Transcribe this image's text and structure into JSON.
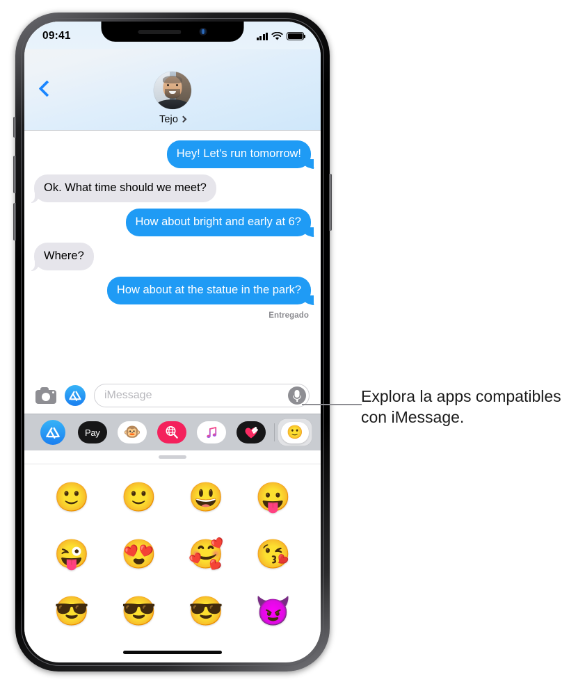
{
  "status_bar": {
    "time": "09:41",
    "signal_icon": "cellular-bars-icon",
    "wifi_icon": "wifi-icon",
    "battery_icon": "battery-full-icon"
  },
  "nav_header": {
    "back_icon": "chevron-left-icon",
    "contact_name": "Tejo",
    "contact_chevron_icon": "chevron-right-icon",
    "avatar_icon": "contact-avatar-photo"
  },
  "conversation": {
    "messages": [
      {
        "text": "Hey! Let's run tomorrow!",
        "side": "out"
      },
      {
        "text": "Ok. What time should we meet?",
        "side": "in"
      },
      {
        "text": "How about bright and early at 6?",
        "side": "out"
      },
      {
        "text": "Where?",
        "side": "in"
      },
      {
        "text": "How about at the statue in the park?",
        "side": "out"
      }
    ],
    "delivery_status": "Entregado"
  },
  "input_bar": {
    "camera_icon": "camera-icon",
    "app_store_icon": "app-store-icon",
    "placeholder": "iMessage",
    "value": "",
    "mic_icon": "microphone-icon"
  },
  "app_drawer": {
    "apps": [
      {
        "name": "app-store-app",
        "icon": "app-store-icon",
        "glyph": ""
      },
      {
        "name": "apple-pay-app",
        "icon": "apple-pay-icon",
        "glyph": " Pay"
      },
      {
        "name": "animoji-app",
        "icon": "monkey-animoji-icon",
        "glyph": "🐵"
      },
      {
        "name": "images-search-app",
        "icon": "images-search-icon",
        "glyph": ""
      },
      {
        "name": "music-app",
        "icon": "music-note-icon",
        "glyph": "♫"
      },
      {
        "name": "digital-touch-app",
        "icon": "digital-touch-heart-icon",
        "glyph": ""
      }
    ],
    "selected_app": {
      "name": "emoji-stickers-app",
      "icon": "smiley-face-icon",
      "glyph": "🙂"
    },
    "grabber_icon": "drag-handle-icon"
  },
  "sticker_grid": {
    "stickers": [
      "🙂",
      "🙂",
      "😃",
      "😛",
      "😜",
      "😍",
      "🥰",
      "😘",
      "😎",
      "😎",
      "😎",
      "😈"
    ]
  },
  "callout": {
    "text": "Explora la apps compatibles con iMessage."
  },
  "home_indicator_icon": "home-indicator-bar",
  "colors": {
    "imessage_blue": "#1f9bf5",
    "incoming_gray": "#e6e5eb",
    "accent_blue": "#1a86ff",
    "drawer_gray": "#c9ccd1",
    "status_text_gray": "#8b8b90"
  }
}
